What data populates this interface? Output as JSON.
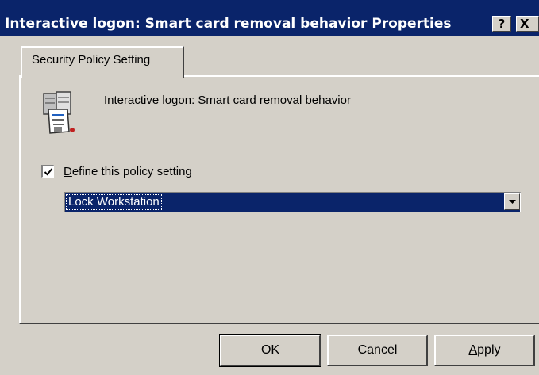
{
  "window": {
    "title": "Interactive logon: Smart card removal behavior Properties",
    "help_button": "?",
    "close_button": "X"
  },
  "tabs": [
    {
      "label": "Security Policy Setting",
      "selected": true
    }
  ],
  "policy": {
    "name": "Interactive logon: Smart card removal behavior",
    "icon": "security-policy-icon"
  },
  "define_setting": {
    "checked": true,
    "label_accel": "D",
    "label_rest": "efine this policy setting"
  },
  "dropdown": {
    "selected_value": "Lock Workstation"
  },
  "buttons": {
    "ok": "OK",
    "cancel": "Cancel",
    "apply_accel": "A",
    "apply_rest": "pply"
  },
  "colors": {
    "titlebar": "#0a246a",
    "face": "#d4d0c8",
    "selection": "#0a246a"
  }
}
